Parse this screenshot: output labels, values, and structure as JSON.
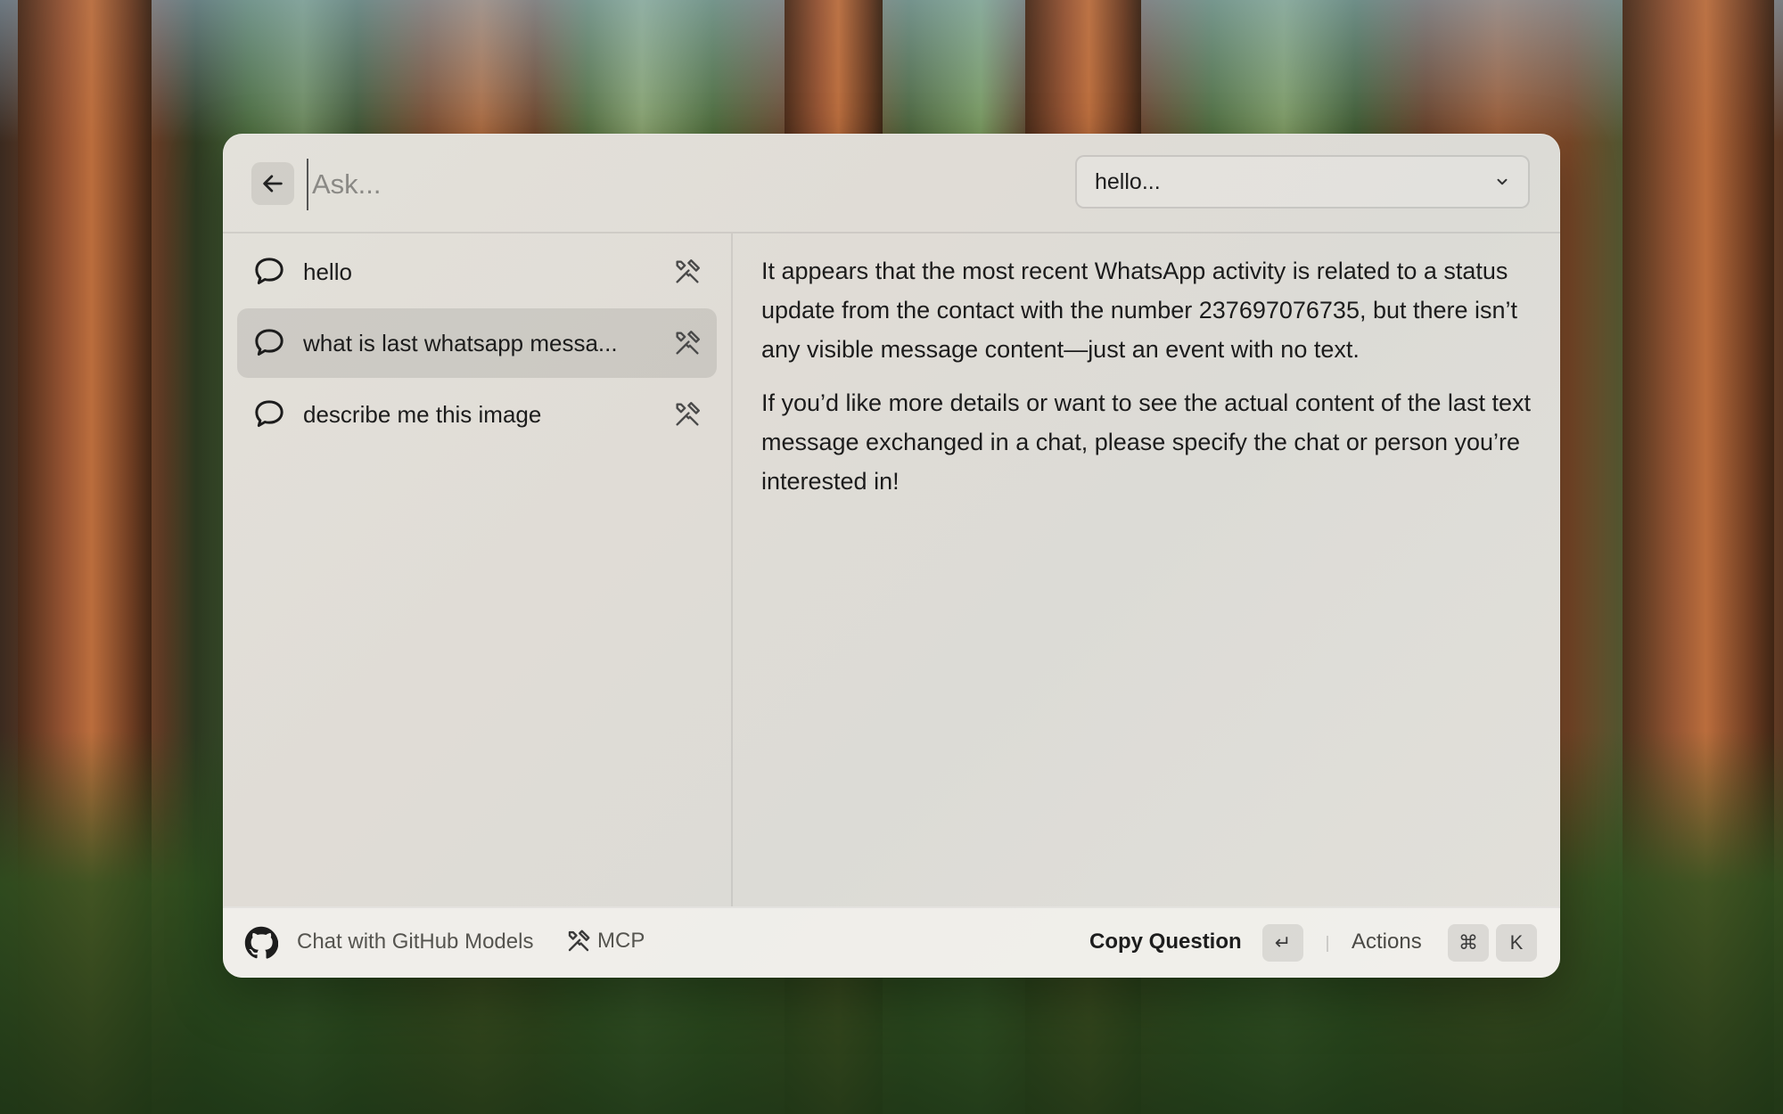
{
  "header": {
    "ask_placeholder": "Ask...",
    "model_select_value": "hello..."
  },
  "sidebar": {
    "items": [
      {
        "label": "hello",
        "active": false
      },
      {
        "label": "what is last whatsapp messa...",
        "active": true
      },
      {
        "label": "describe me this image",
        "active": false
      }
    ]
  },
  "content": {
    "paragraphs": [
      "It appears that the most recent WhatsApp activity is related to a status update from the contact with the number 237697076735, but there isn’t any visible message content—just an event with no text.",
      "If you’d like more details or want to see the actual content of the last text message exchanged in a chat, please specify the chat or person you’re interested in!"
    ]
  },
  "footer": {
    "title": "Chat with GitHub Models",
    "mcp_label": "MCP",
    "copy_question_label": "Copy Question",
    "enter_key": "↵",
    "actions_label": "Actions",
    "cmd_key": "⌘",
    "k_key": "K"
  },
  "icons": {
    "back": "arrow-left-icon",
    "chevron": "chevron-down-icon",
    "chat": "chat-bubble-icon",
    "tools": "tools-icon",
    "github": "github-icon"
  }
}
